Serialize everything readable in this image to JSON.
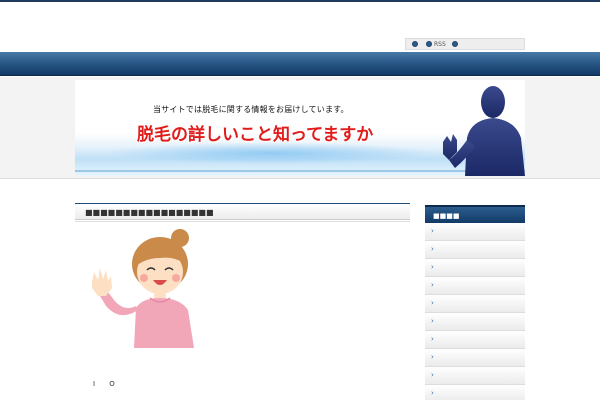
{
  "header": {
    "utility_links": [
      {
        "label": ""
      },
      {
        "label": "RSS"
      },
      {
        "label": ""
      }
    ]
  },
  "banner": {
    "subtitle": "当サイトでは脱毛に関する情報をお届けしています。",
    "title": "脱毛の詳しいこと知ってますか"
  },
  "main": {
    "post_title": "■■■■■■■■■■■■■■■■■",
    "body_text": "I O"
  },
  "sidebar": {
    "title": "■■■■",
    "items": [
      {
        "label": "›"
      },
      {
        "label": "›"
      },
      {
        "label": "›"
      },
      {
        "label": "›"
      },
      {
        "label": "›"
      },
      {
        "label": "›"
      },
      {
        "label": "›"
      },
      {
        "label": "›"
      },
      {
        "label": "›"
      },
      {
        "label": "›"
      }
    ]
  },
  "colors": {
    "nav": "#2a5888",
    "banner_title": "#e21b1b",
    "accent": "#1e4c7a"
  }
}
